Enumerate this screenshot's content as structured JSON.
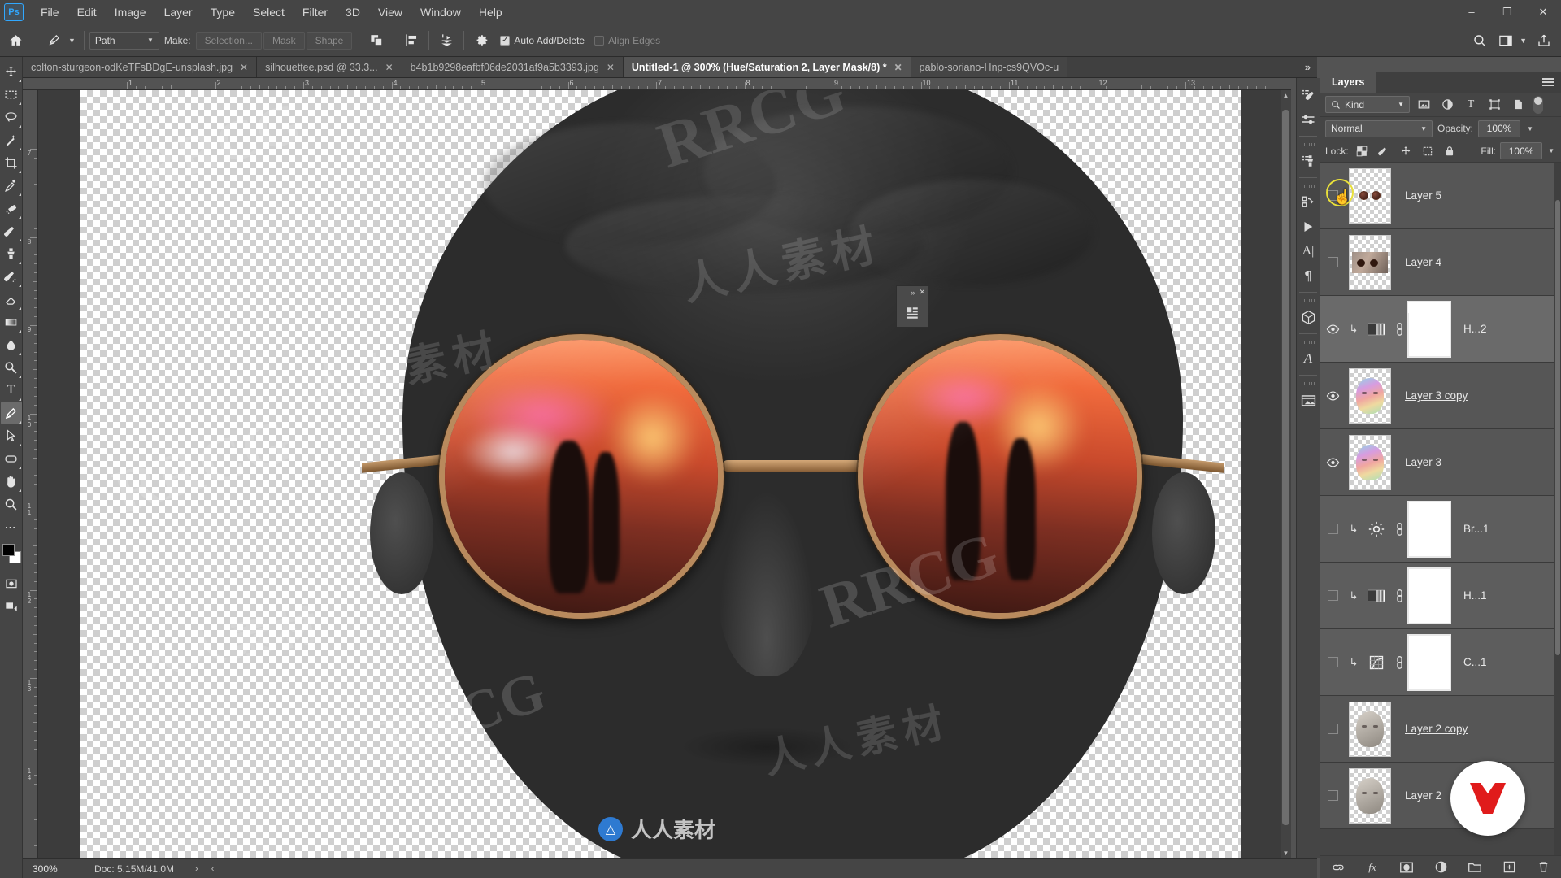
{
  "app": {
    "name": "Ps",
    "title": "Adobe Photoshop"
  },
  "menubar": {
    "items": [
      "File",
      "Edit",
      "Image",
      "Layer",
      "Type",
      "Select",
      "Filter",
      "3D",
      "View",
      "Window",
      "Help"
    ]
  },
  "window_controls": {
    "minimize": "–",
    "maximize": "❐",
    "close": "✕"
  },
  "options_bar": {
    "home_icon": "home-icon",
    "tool_icon": "pen-tool-icon",
    "mode_select": "Path",
    "make_label": "Make:",
    "selection_button": "Selection...",
    "mask_button": "Mask",
    "shape_button": "Shape",
    "path_operations_icon": "path-operations-icon",
    "path_alignment_icon": "path-alignment-icon",
    "path_arrangement_icon": "path-arrangement-icon",
    "gear_icon": "gear-icon",
    "auto_add_delete": {
      "label": "Auto Add/Delete",
      "checked": true
    },
    "align_edges": {
      "label": "Align Edges",
      "checked": false
    },
    "search_icon": "search-icon",
    "workspace_icon": "workspace-icon",
    "share_icon": "share-icon"
  },
  "tabs": {
    "items": [
      {
        "label": "colton-sturgeon-odKeTFsBDgE-unsplash.jpg",
        "active": false
      },
      {
        "label": "silhouettee.psd @ 33.3...",
        "active": false
      },
      {
        "label": "b4b1b9298eafbf06de2031af9a5b3393.jpg",
        "active": false
      },
      {
        "label": "Untitled-1 @ 300% (Hue/Saturation 2, Layer Mask/8) *",
        "active": true
      },
      {
        "label": "pablo-soriano-Hnp-cs9QVOc-u",
        "active": false
      }
    ],
    "overflow": "»"
  },
  "toolbar": {
    "tools": [
      {
        "name": "move-tool",
        "glyph": "✥",
        "selected": false,
        "has_flyout": true
      },
      {
        "name": "rectangular-marquee-tool",
        "glyph": "⬚",
        "selected": false,
        "has_flyout": true
      },
      {
        "name": "lasso-tool",
        "glyph": "➰",
        "selected": false,
        "has_flyout": true
      },
      {
        "name": "magic-wand-tool",
        "glyph": "✨",
        "selected": false,
        "has_flyout": true
      },
      {
        "name": "crop-tool",
        "glyph": "⌸",
        "selected": false,
        "has_flyout": true
      },
      {
        "name": "eyedropper-tool",
        "glyph": "✒",
        "selected": false,
        "has_flyout": true
      },
      {
        "name": "spot-healing-brush-tool",
        "glyph": "⚒",
        "selected": false,
        "has_flyout": true
      },
      {
        "name": "brush-tool",
        "glyph": "✎",
        "selected": false,
        "has_flyout": true
      },
      {
        "name": "clone-stamp-tool",
        "glyph": "♟",
        "selected": false,
        "has_flyout": true
      },
      {
        "name": "history-brush-tool",
        "glyph": "✐",
        "selected": false,
        "has_flyout": true
      },
      {
        "name": "eraser-tool",
        "glyph": "▱",
        "selected": false,
        "has_flyout": true
      },
      {
        "name": "gradient-tool",
        "glyph": "▤",
        "selected": false,
        "has_flyout": true
      },
      {
        "name": "blur-tool",
        "glyph": "◖",
        "selected": false,
        "has_flyout": true
      },
      {
        "name": "dodge-tool",
        "glyph": "⚲",
        "selected": false,
        "has_flyout": true
      },
      {
        "name": "type-tool",
        "glyph": "T",
        "selected": false,
        "has_flyout": true
      },
      {
        "name": "pen-tool",
        "glyph": "✒",
        "selected": true,
        "has_flyout": true
      },
      {
        "name": "path-selection-tool",
        "glyph": "➤",
        "selected": false,
        "has_flyout": true
      },
      {
        "name": "rectangle-tool",
        "glyph": "▭",
        "selected": false,
        "has_flyout": true
      },
      {
        "name": "hand-tool",
        "glyph": "✋",
        "selected": false,
        "has_flyout": true
      },
      {
        "name": "zoom-tool",
        "glyph": "⌕",
        "selected": false,
        "has_flyout": false
      },
      {
        "name": "edit-toolbar-button",
        "glyph": "…",
        "selected": false,
        "has_flyout": false
      }
    ],
    "foreground_color": "#000000",
    "background_color": "#ffffff",
    "quick_mask_icon": "quick-mask-icon",
    "screen_mode_icon": "screen-mode-icon"
  },
  "canvas": {
    "ruler_top_labels": [
      "1",
      "2",
      "3",
      "4",
      "5",
      "6",
      "7",
      "8",
      "9",
      "10",
      "11",
      "12",
      "13"
    ],
    "ruler_left_labels": [
      "7",
      "8",
      "9",
      "10",
      "11",
      "12",
      "13",
      "14"
    ],
    "floating_panel": {
      "collapse": "»",
      "close": "✕",
      "icon": "properties-panel-icon"
    },
    "watermark_latin": "RRCG",
    "watermark_cjk": "人人素材",
    "bottom_watermark_text": "人人素材"
  },
  "status_bar": {
    "zoom": "300%",
    "doc_info": "Doc: 5.15M/41.0M",
    "next_arrow": "›",
    "prev_arrow": "‹"
  },
  "icon_dock": {
    "items": [
      {
        "name": "brushes-panel-icon",
        "glyph": "✎"
      },
      {
        "name": "brush-settings-panel-icon",
        "glyph": "☰"
      },
      {
        "name": "clone-source-panel-icon",
        "glyph": "⚙"
      },
      {
        "name": "history-panel-icon",
        "glyph": "↺"
      },
      {
        "name": "actions-panel-icon",
        "glyph": "▶"
      },
      {
        "name": "character-panel-icon",
        "glyph": "A"
      },
      {
        "name": "paragraph-panel-icon",
        "glyph": "¶"
      },
      {
        "name": "3d-panel-icon",
        "glyph": "⬜"
      },
      {
        "name": "glyphs-panel-icon",
        "glyph": "𝒜"
      },
      {
        "name": "libraries-panel-icon",
        "glyph": "🗀"
      }
    ]
  },
  "layers_panel": {
    "tab_label": "Layers",
    "menu_icon": "panel-menu-icon",
    "filter": {
      "kind_label": "Kind",
      "search_icon": "search-icon",
      "pixel_filter_icon": "pixel-layer-filter-icon",
      "adjustment_filter_icon": "adjustment-layer-filter-icon",
      "type_filter_icon": "type-layer-filter-icon",
      "shape_filter_icon": "shape-layer-filter-icon",
      "smart_object_filter_icon": "smart-object-filter-icon",
      "filter_toggle_icon": "filter-toggle-switch"
    },
    "blend_mode": "Normal",
    "opacity_label": "Opacity:",
    "opacity_value": "100%",
    "lock_label": "Lock:",
    "lock_icons": [
      {
        "name": "lock-transparent-pixels-icon"
      },
      {
        "name": "lock-image-pixels-icon"
      },
      {
        "name": "lock-position-icon"
      },
      {
        "name": "lock-artboard-nesting-icon"
      },
      {
        "name": "lock-all-icon"
      }
    ],
    "fill_label": "Fill:",
    "fill_value": "100%",
    "layers": [
      {
        "name": "Layer 5",
        "visible": false,
        "type": "pixel",
        "thumb": "glasses",
        "selected": false,
        "clipped": false,
        "renaming": false
      },
      {
        "name": "Layer 4",
        "visible": false,
        "type": "pixel",
        "thumb": "photo",
        "selected": false,
        "clipped": false,
        "renaming": false
      },
      {
        "name": "H...2",
        "visible": true,
        "type": "adjustment",
        "adj_icon": "hue-saturation-icon",
        "selected": true,
        "clipped": true,
        "linked": true,
        "renaming": false
      },
      {
        "name": "Layer 3 copy",
        "visible": true,
        "type": "pixel",
        "thumb": "face-rainbow",
        "selected": false,
        "clipped": false,
        "renaming": true
      },
      {
        "name": "Layer 3",
        "visible": true,
        "type": "pixel",
        "thumb": "face-rainbow",
        "selected": false,
        "clipped": false,
        "renaming": false
      },
      {
        "name": "Br...1",
        "visible": false,
        "type": "adjustment",
        "adj_icon": "brightness-contrast-icon",
        "selected": false,
        "clipped": true,
        "linked": true,
        "renaming": false
      },
      {
        "name": "H...1",
        "visible": false,
        "type": "adjustment",
        "adj_icon": "hue-saturation-icon",
        "selected": false,
        "clipped": true,
        "linked": true,
        "renaming": false
      },
      {
        "name": "C...1",
        "visible": false,
        "type": "adjustment",
        "adj_icon": "curves-icon",
        "selected": false,
        "clipped": true,
        "linked": true,
        "renaming": false
      },
      {
        "name": "Layer 2 copy",
        "visible": false,
        "type": "pixel",
        "thumb": "face-stone",
        "selected": false,
        "clipped": false,
        "renaming": true
      },
      {
        "name": "Layer 2",
        "visible": false,
        "type": "pixel",
        "thumb": "face-stone",
        "selected": false,
        "clipped": false,
        "renaming": false
      }
    ],
    "footer_icons": [
      {
        "name": "link-layers-icon",
        "glyph": "⚭"
      },
      {
        "name": "layer-style-icon",
        "glyph": "fx"
      },
      {
        "name": "add-layer-mask-icon",
        "glyph": "▣"
      },
      {
        "name": "new-fill-adjustment-layer-icon",
        "glyph": "◑"
      },
      {
        "name": "new-group-icon",
        "glyph": "📁"
      },
      {
        "name": "new-layer-icon",
        "glyph": "⊞"
      },
      {
        "name": "delete-layer-icon",
        "glyph": "🗑"
      }
    ]
  },
  "colors": {
    "panel_bg": "#454545",
    "canvas_bg": "#3c3c3c",
    "row_bg": "#565656",
    "row_selected": "#6a6a6a",
    "accent_blue": "#31a8ff",
    "highlight_yellow": "#e9e03a",
    "badge_red": "#e01b1b"
  }
}
